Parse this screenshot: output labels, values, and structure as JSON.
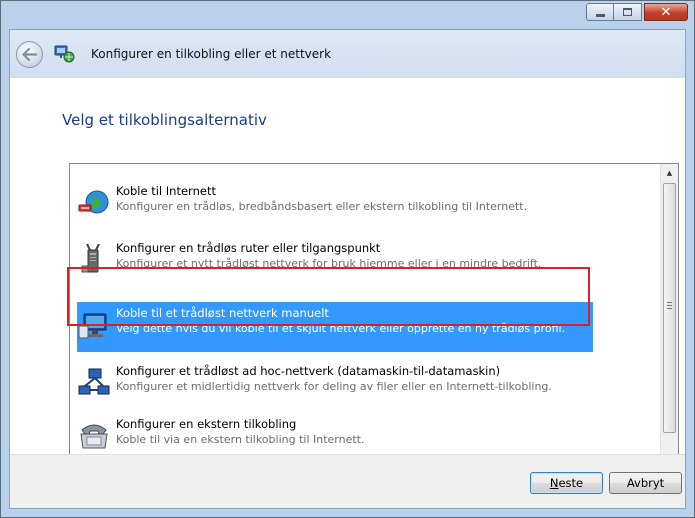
{
  "window": {
    "nav_title": "Konfigurer en tilkobling eller et nettverk",
    "caption_buttons": [
      "minimize",
      "maximize",
      "close"
    ]
  },
  "page": {
    "heading": "Velg et tilkoblingsalternativ"
  },
  "options": [
    {
      "title": "Koble til Internett",
      "description": "Konfigurer en trådløs, bredbåndsbasert eller ekstern tilkobling til Internett.",
      "icon": "globe-network-icon",
      "selected": false
    },
    {
      "title": "Konfigurer en trådløs ruter eller tilgangspunkt",
      "description": "Konfigurer et nytt trådløst nettverk for bruk hjemme eller i en mindre bedrift.",
      "icon": "wireless-router-icon",
      "selected": false
    },
    {
      "title": "Koble til et trådløst nettverk manuelt",
      "description": "Velg dette hvis du vil koble til et skjult nettverk eller opprette en ny trådløs profil.",
      "icon": "wireless-computer-icon",
      "selected": true
    },
    {
      "title": "Konfigurer et trådløst ad hoc-nettverk (datamaskin-til-datamaskin)",
      "description": "Konfigurer et midlertidig nettverk for deling av filer eller en Internett-tilkobling.",
      "icon": "adhoc-network-icon",
      "selected": false
    },
    {
      "title": "Konfigurer en ekstern tilkobling",
      "description": "Koble til via en ekstern tilkobling til Internett.",
      "icon": "dialup-phone-icon",
      "selected": false
    }
  ],
  "footer": {
    "next_prefix": "",
    "next_access": "N",
    "next_rest": "este",
    "cancel_label": "Avbryt"
  },
  "colors": {
    "selection": "#3399ff",
    "highlight_border": "#d6202a",
    "heading": "#1e3a8a"
  }
}
